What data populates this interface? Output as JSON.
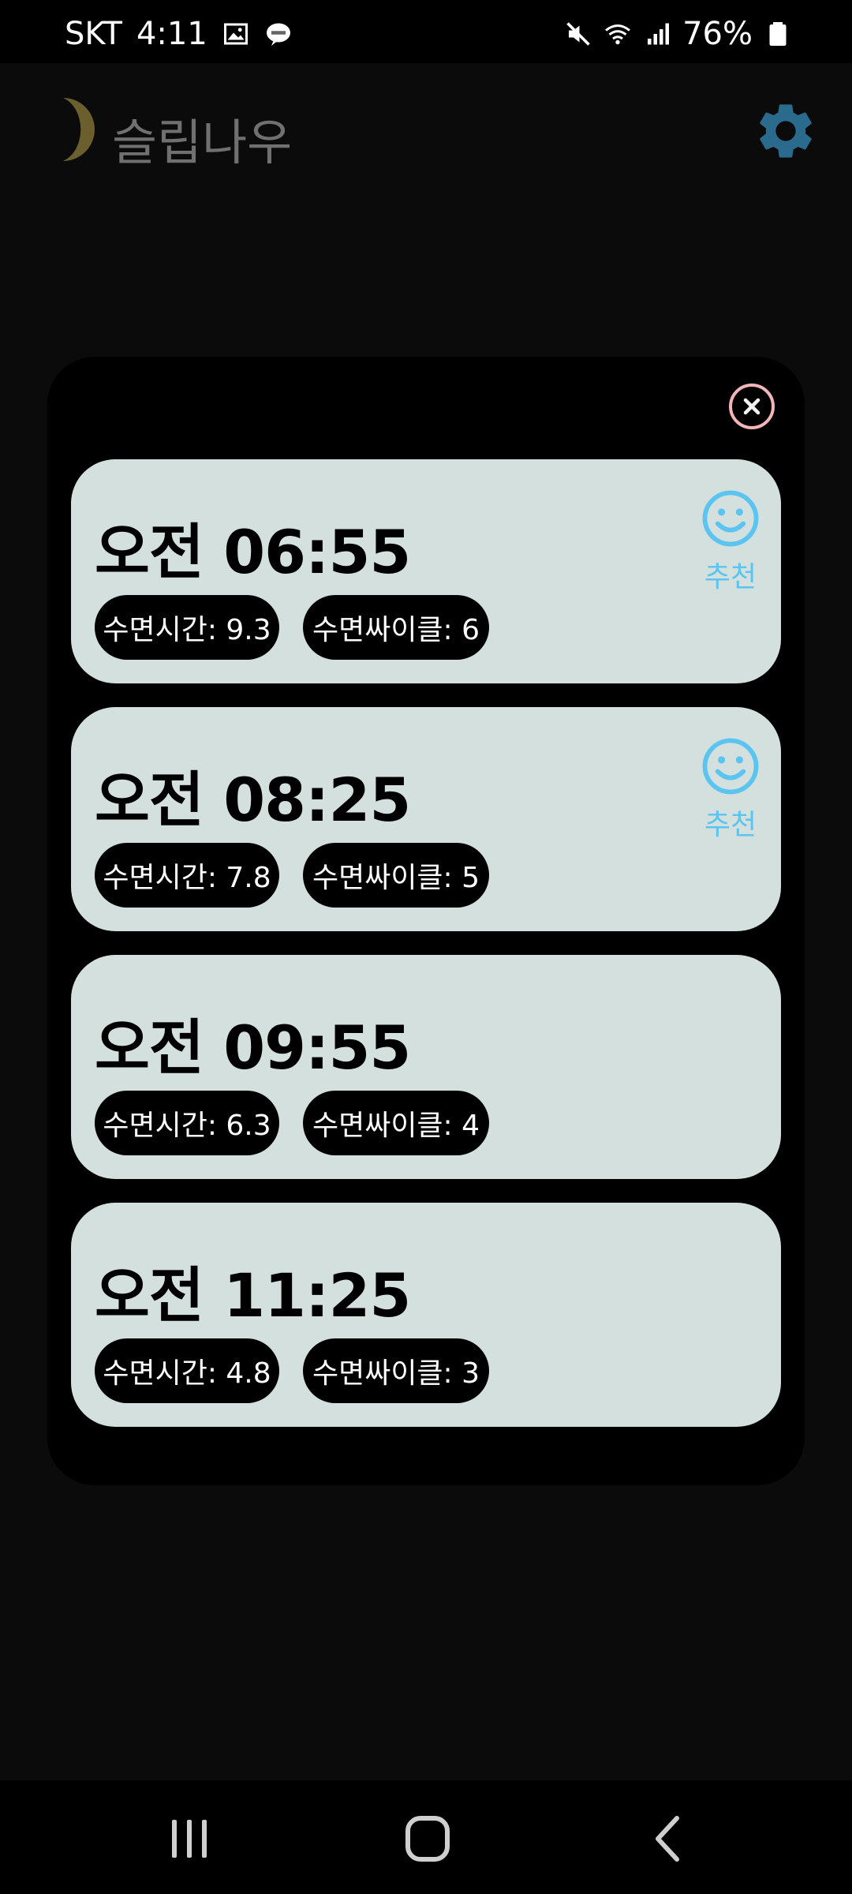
{
  "status_bar": {
    "carrier": "SKT",
    "time": "4:11",
    "battery": "76%"
  },
  "app": {
    "title": "슬립나우"
  },
  "dialog": {
    "cards": [
      {
        "time": "오전 06:55",
        "sleep_hours": "수면시간: 9.3",
        "sleep_cycles": "수면싸이클: 6",
        "recommended": true,
        "rec_label": "추천"
      },
      {
        "time": "오전 08:25",
        "sleep_hours": "수면시간: 7.8",
        "sleep_cycles": "수면싸이클: 5",
        "recommended": true,
        "rec_label": "추천"
      },
      {
        "time": "오전 09:55",
        "sleep_hours": "수면시간: 6.3",
        "sleep_cycles": "수면싸이클: 4",
        "recommended": false
      },
      {
        "time": "오전 11:25",
        "sleep_hours": "수면시간: 4.8",
        "sleep_cycles": "수면싸이클: 3",
        "recommended": false
      }
    ]
  },
  "colors": {
    "card_bg": "#d3e0dd",
    "recommend_accent": "#5bc4f1",
    "close_ring": "#f2b6b9",
    "moon": "#6b5f2e",
    "gear": "#2a6a8c"
  }
}
